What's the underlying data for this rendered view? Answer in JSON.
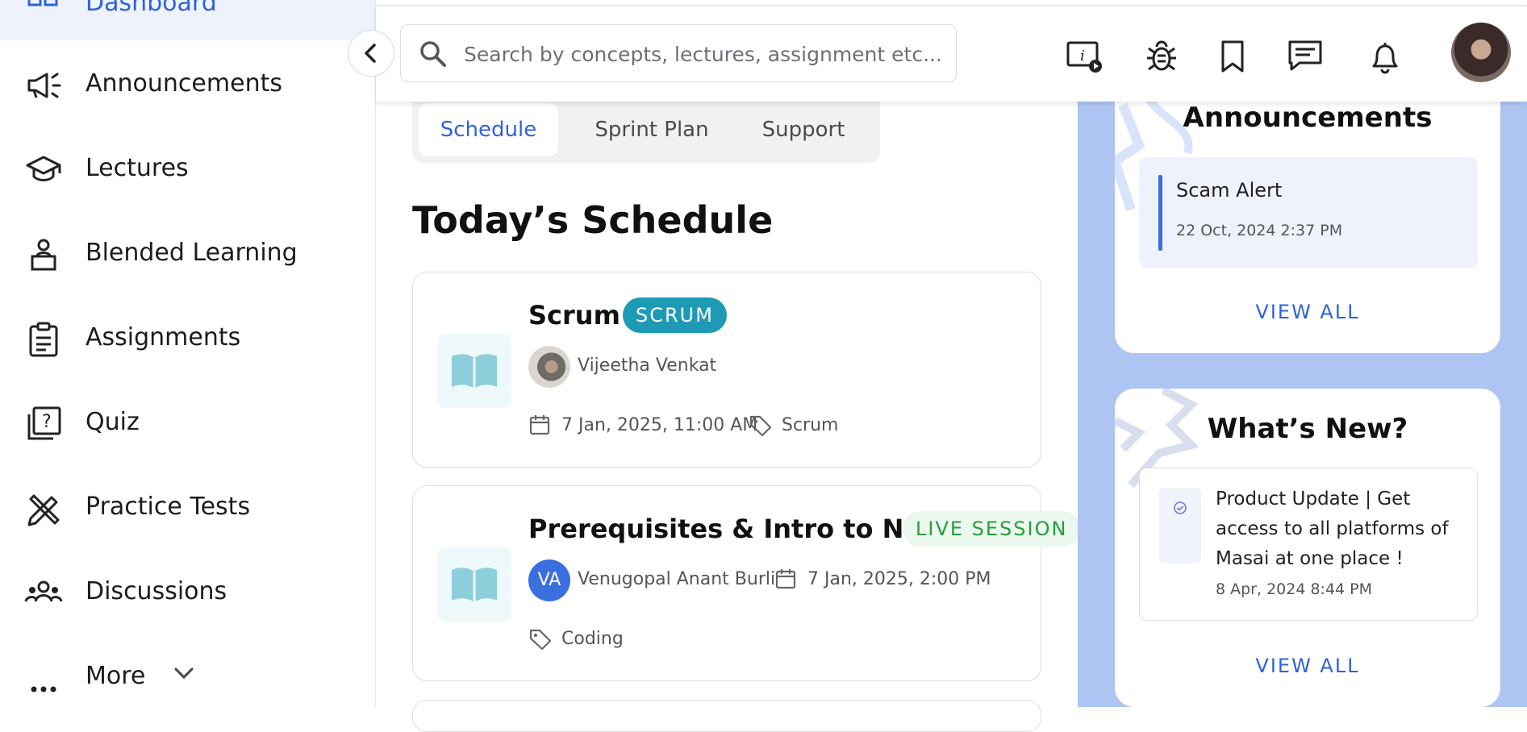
{
  "sidebar": {
    "active_item": {
      "label": "Dashboard",
      "icon": "dashboard-icon"
    },
    "items": [
      {
        "label": "Announcements",
        "icon": "megaphone-icon"
      },
      {
        "label": "Lectures",
        "icon": "graduation-cap-icon"
      },
      {
        "label": "Blended Learning",
        "icon": "person-desk-icon"
      },
      {
        "label": "Assignments",
        "icon": "clipboard-icon"
      },
      {
        "label": "Quiz",
        "icon": "question-box-icon"
      },
      {
        "label": "Practice Tests",
        "icon": "pencil-ruler-icon"
      },
      {
        "label": "Discussions",
        "icon": "group-icon"
      },
      {
        "label": "More",
        "icon": "more-dots-icon"
      }
    ]
  },
  "topbar": {
    "search_placeholder": "Search by concepts, lectures, assignment etc...",
    "icons": [
      "info-video-icon",
      "bug-icon",
      "bookmark-icon",
      "chat-icon",
      "bell-icon"
    ]
  },
  "tabs": [
    {
      "label": "Schedule",
      "active": true
    },
    {
      "label": "Sprint Plan",
      "active": false
    },
    {
      "label": "Support",
      "active": false
    }
  ],
  "schedule": {
    "title": "Today’s Schedule",
    "sessions": [
      {
        "title": "Scrum",
        "badge": "SCRUM",
        "instructor": "Vijeetha Venkat",
        "datetime": "7 Jan, 2025, 11:00 AM",
        "tag": "Scrum"
      },
      {
        "title": "Prerequisites & Intro to Nod...",
        "badge": "LIVE SESSION",
        "instructor_initials": "VA",
        "instructor": "Venugopal Anant Burli",
        "datetime": "7 Jan, 2025, 2:00 PM",
        "tag": "Coding"
      }
    ]
  },
  "announcements_panel": {
    "title": "Announcements",
    "item": {
      "title": "Scam Alert",
      "date": "22 Oct, 2024 2:37 PM"
    },
    "view_all": "VIEW ALL"
  },
  "whats_new_panel": {
    "title": "What’s New?",
    "item": {
      "text": "Product Update | Get access to all platforms of Masai at one place !",
      "date": "8 Apr, 2024 8:44 PM"
    },
    "view_all": "VIEW ALL"
  },
  "colors": {
    "accent": "#2f62d9",
    "scrum_badge": "#1e9ab5",
    "live_badge_text": "#2c9a3e",
    "right_panel_bg": "#aec4f3"
  }
}
